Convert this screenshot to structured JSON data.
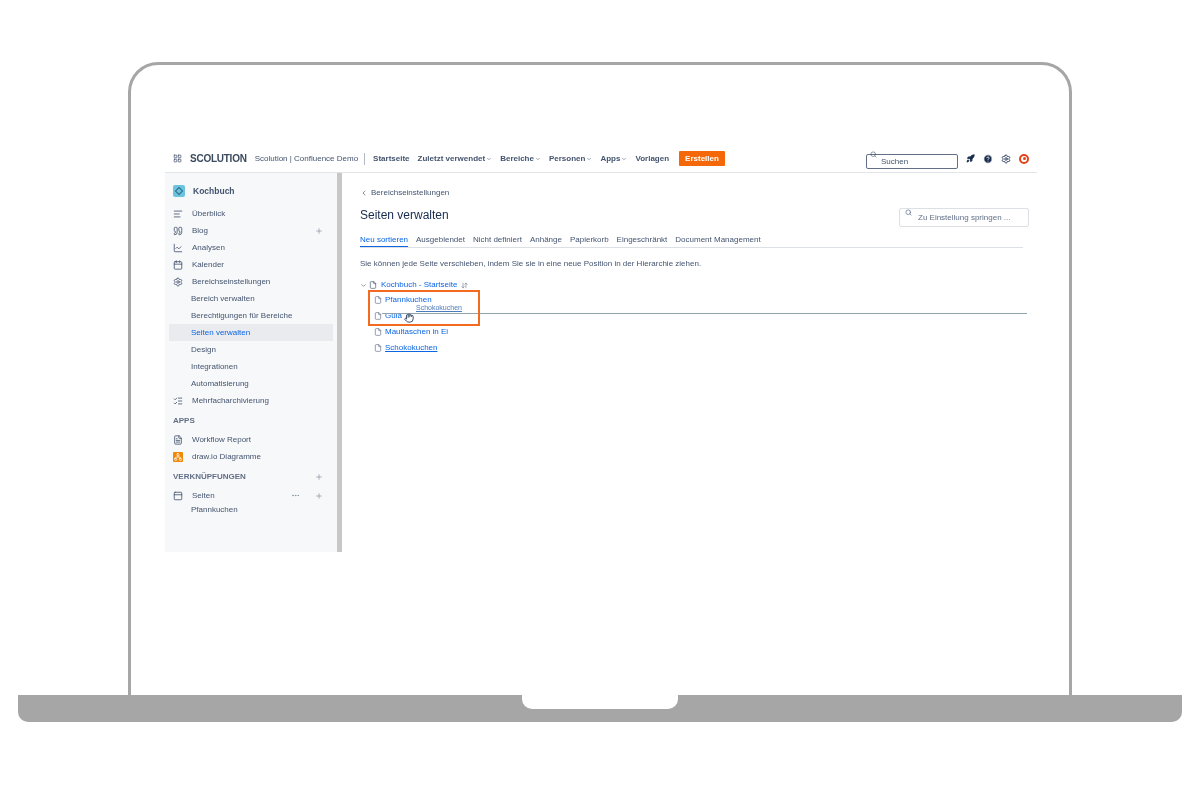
{
  "topbar": {
    "logo": "SCOLUTION",
    "site": "Scolution | Confluence Demo",
    "nav": [
      {
        "label": "Startseite",
        "dropdown": false
      },
      {
        "label": "Zuletzt verwendet",
        "dropdown": true
      },
      {
        "label": "Bereiche",
        "dropdown": true
      },
      {
        "label": "Personen",
        "dropdown": true
      },
      {
        "label": "Apps",
        "dropdown": true
      },
      {
        "label": "Vorlagen",
        "dropdown": false
      }
    ],
    "create": "Erstellen",
    "search": {
      "placeholder": "Suchen"
    }
  },
  "sidebar": {
    "space": "Kochbuch",
    "items": [
      {
        "kind": "item",
        "label": "Überblick",
        "selected": false
      },
      {
        "kind": "item",
        "label": "Blog",
        "selected": false,
        "plus": true
      },
      {
        "kind": "item",
        "label": "Analysen",
        "selected": false
      },
      {
        "kind": "item",
        "label": "Kalender",
        "selected": false
      },
      {
        "kind": "item",
        "label": "Bereichseinstellungen",
        "selected": false
      },
      {
        "kind": "sub",
        "label": "Bereich verwalten",
        "selected": false
      },
      {
        "kind": "sub",
        "label": "Berechtigungen für Bereiche",
        "selected": false
      },
      {
        "kind": "sub",
        "label": "Seiten verwalten",
        "selected": true
      },
      {
        "kind": "sub",
        "label": "Design",
        "selected": false
      },
      {
        "kind": "sub",
        "label": "Integrationen",
        "selected": false
      },
      {
        "kind": "sub",
        "label": "Automatisierung",
        "selected": false
      },
      {
        "kind": "item",
        "label": "Mehrfacharchivierung",
        "selected": false
      },
      {
        "kind": "section",
        "label": "APPS"
      },
      {
        "kind": "item",
        "label": "Workflow Report",
        "selected": false
      },
      {
        "kind": "item",
        "label": "draw.io Diagramme",
        "selected": false
      },
      {
        "kind": "section",
        "label": "VERKNÜPFUNGEN",
        "plus": true
      },
      {
        "kind": "item",
        "label": "Seiten",
        "selected": false,
        "plus": true,
        "more": true
      },
      {
        "kind": "page",
        "label": "Pfannkuchen",
        "selected": false
      }
    ]
  },
  "main": {
    "breadcrumb": "Bereichseinstellungen",
    "title": "Seiten verwalten",
    "jump": {
      "placeholder": "Zu Einstellung springen ..."
    },
    "tabs": [
      {
        "label": "Neu sortieren",
        "selected": true
      },
      {
        "label": "Ausgeblendet",
        "selected": false
      },
      {
        "label": "Nicht definiert",
        "selected": false
      },
      {
        "label": "Anhänge",
        "selected": false
      },
      {
        "label": "Papierkorb",
        "selected": false
      },
      {
        "label": "Eingeschränkt",
        "selected": false
      },
      {
        "label": "Document Management",
        "selected": false
      }
    ],
    "hint": "Sie können jede Seite verschieben, indem Sie sie in eine neue Position in der Hierarchie ziehen.",
    "tree": {
      "label": "Kochbuch - Startseite",
      "expanded": true,
      "children": [
        {
          "label": "Pfannkuchen",
          "hovered": false
        },
        {
          "label": "Gula",
          "hovered": false
        },
        {
          "label": "Maultaschen in Ei",
          "hovered": false
        },
        {
          "label": "Schokokuchen",
          "hovered": true
        }
      ]
    },
    "drag": {
      "label": "Schokokuchen"
    }
  }
}
